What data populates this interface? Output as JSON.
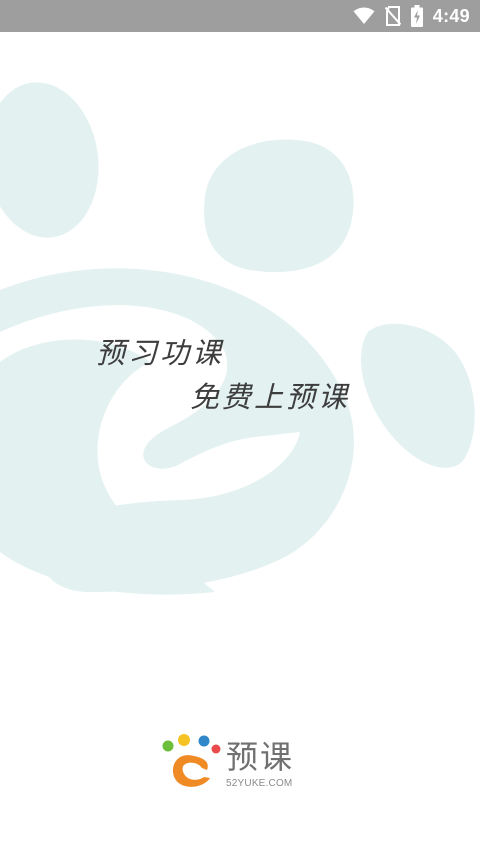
{
  "status_bar": {
    "time": "4:49",
    "icons": [
      "wifi-icon",
      "no-sim-icon",
      "battery-charging-icon"
    ]
  },
  "slogan": {
    "line1": "预习功课",
    "line2": "免费上预课"
  },
  "logo": {
    "name": "预课",
    "url": "52YUKE.COM",
    "colors": {
      "orange": "#f08a24",
      "blue": "#2f86c9",
      "green": "#6cbf3b",
      "yellow": "#f6c324",
      "red": "#e94b4b"
    }
  },
  "theme": {
    "status_bar_bg": "#9e9e9e",
    "decoration_color": "#e3f1f1",
    "background": "#ffffff"
  }
}
